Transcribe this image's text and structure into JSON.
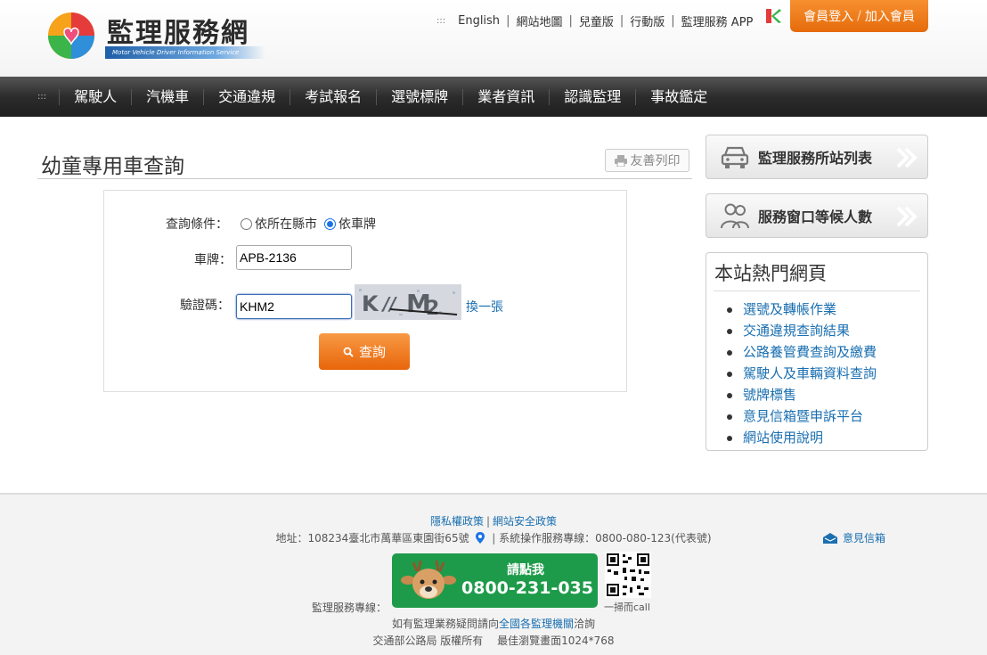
{
  "header": {
    "logo_title": "監理服務網",
    "logo_subtitle": "Motor Vehicle Driver Information Service",
    "top_links": [
      "English",
      "網站地圖",
      "兒童版",
      "行動版",
      "監理服務 APP"
    ],
    "top_dots": ":::",
    "member_login": "會員登入",
    "member_join": "加入會員"
  },
  "nav": {
    "dots": ":::",
    "items": [
      "駕駛人",
      "汽機車",
      "交通違規",
      "考試報名",
      "選號標牌",
      "業者資訊",
      "認識監理",
      "事故鑑定"
    ]
  },
  "main": {
    "title": "幼童專用車查詢",
    "print_label": "友善列印",
    "query_condition_label": "查詢條件：",
    "radio_city": "依所在縣市",
    "radio_plate": "依車牌",
    "plate_label": "車牌：",
    "plate_value": "APB-2136",
    "captcha_label": "驗證碼：",
    "captcha_value": "KHM2",
    "refresh_label": "換一張",
    "query_button": "查詢"
  },
  "sidebar": {
    "station_list": "監理服務所站列表",
    "waiting_count": "服務窗口等候人數",
    "hot_title": "本站熱門網頁",
    "hot_links": [
      "選號及轉帳作業",
      "交通違規查詢結果",
      "公路養管費查詢及繳費",
      "駕駛人及車輛資料查詢",
      "號牌標售",
      "意見信箱暨申訴平台",
      "網站使用說明"
    ]
  },
  "footer": {
    "privacy": "隱私權政策",
    "security": "網站安全政策",
    "address": "地址：108234臺北市萬華區東園街65號",
    "service_line": "系統操作服務專線：0800-080-123(代表號)",
    "mailbox": "意見信箱",
    "hotline_label": "監理服務專線：",
    "call_me": "請點我",
    "hotline_number": "0800-231-035",
    "scan_call": "一掃而call",
    "contact_prefix": "如有監理業務疑問請向",
    "contact_link": "全國各監理機關",
    "contact_suffix": "洽詢",
    "copyright": "交通部公路局 版權所有　 最佳瀏覽畫面1024*768"
  },
  "colors": {
    "accent_orange": "#e8650a",
    "link_blue": "#1a6fb0",
    "nav_dark": "#2c2c2c",
    "footer_green": "#1e9b4a"
  }
}
